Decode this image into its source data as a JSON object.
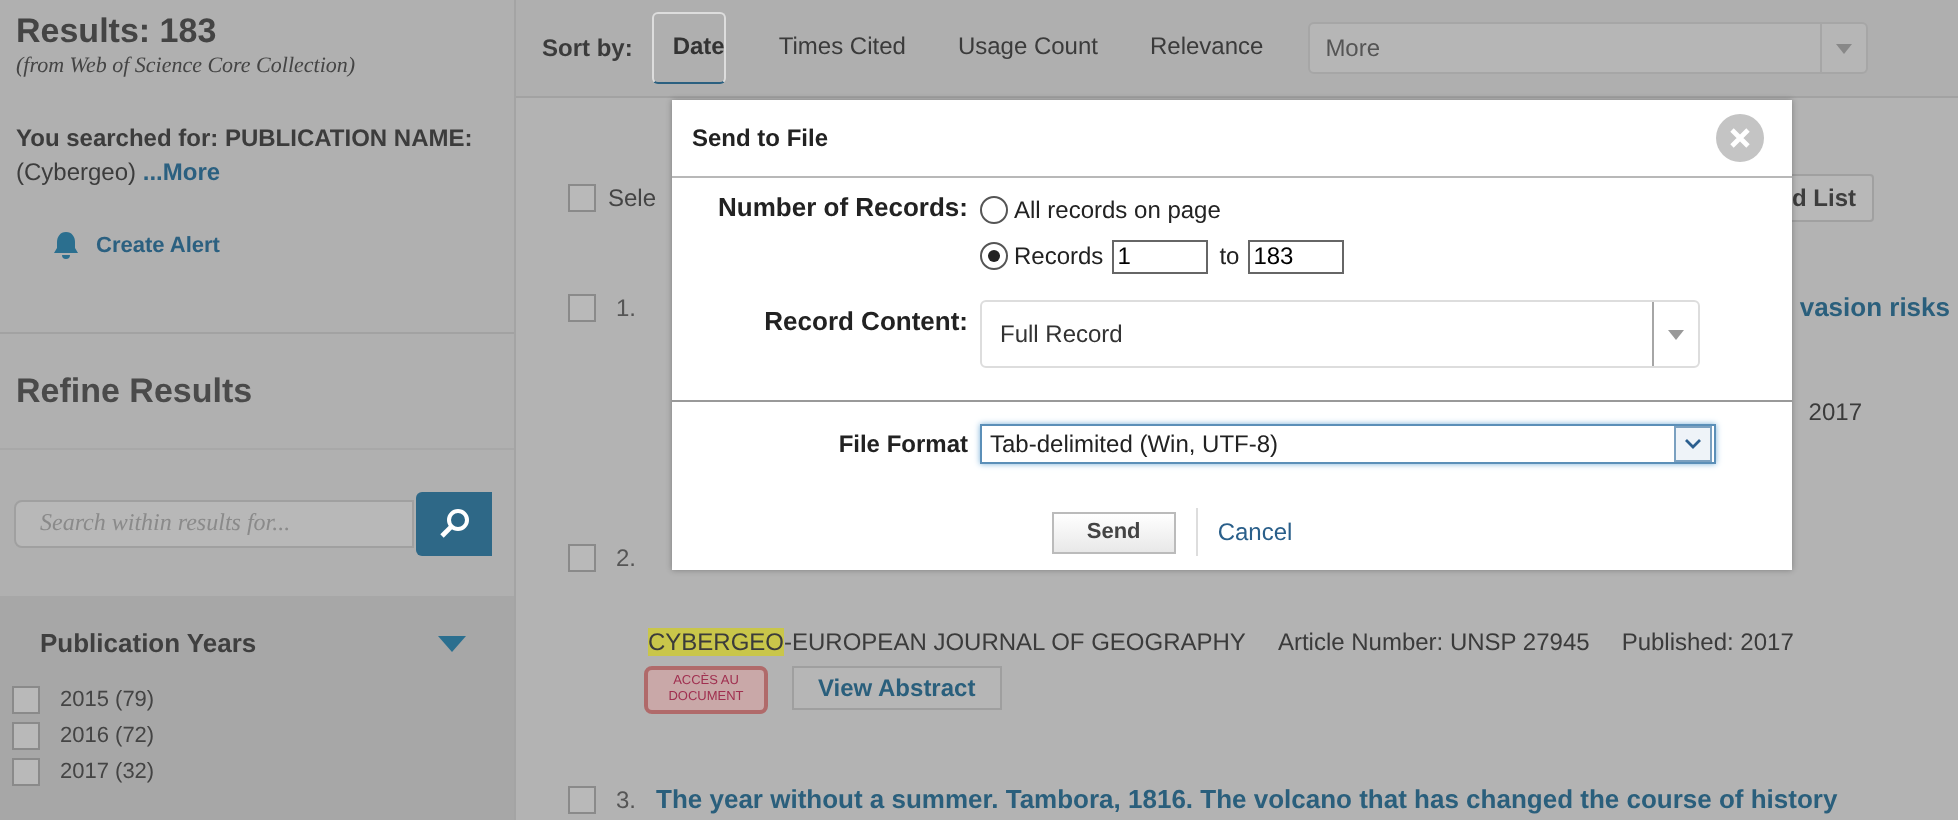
{
  "sidebar": {
    "results_title": "Results: 183",
    "source": "(from Web of Science Core Collection)",
    "search_summary": "**You searched for: PUBLICATION NAME:** (Cybergeo)",
    "more_link": "...More",
    "create_alert": "Create Alert",
    "refine_title": "Refine Results",
    "search": {
      "placeholder": "Search within results for..."
    },
    "facet": {
      "title": "Publication Years",
      "expanded": true,
      "items": [
        {
          "label": "2015 (79)",
          "checked": false
        },
        {
          "label": "2016 (72)",
          "checked": false
        },
        {
          "label": "2017 (32)",
          "checked": false
        }
      ]
    }
  },
  "sort": {
    "label": "Sort by:",
    "options": [
      {
        "label": "Date",
        "selected": true
      },
      {
        "label": "Times Cited",
        "selected": false
      },
      {
        "label": "Usage Count",
        "selected": false
      },
      {
        "label": "Relevance",
        "selected": false
      }
    ],
    "more": "More"
  },
  "results": {
    "select_all": {
      "label": "Sele",
      "checked": false
    },
    "add_list": "d List",
    "items": [
      {
        "number": "1.",
        "checked": false,
        "title": "vasion risks",
        "meta": "2017"
      },
      {
        "number": "2.",
        "checked": false,
        "journal_highlight": "CYBERGEO",
        "journal_rest": "-EUROPEAN JOURNAL OF GEOGRAPHY",
        "article_number": "Article Number: UNSP 27945",
        "published": "Published: 2017",
        "access_button": [
          "ACCÈS AU",
          "DOCUMENT"
        ],
        "abstract_button": "View Abstract"
      },
      {
        "number": "3.",
        "checked": false,
        "title": "The year without a summer. Tambora, 1816. The volcano that has changed the course of history"
      }
    ]
  },
  "dialog": {
    "title": "Send to File",
    "number_label": "Number of Records:",
    "options": [
      {
        "label": "All records on page",
        "selected": false
      },
      {
        "label": "Records",
        "selected": true
      }
    ],
    "from": "1",
    "to_label": "to",
    "to": "183",
    "content_label": "Record Content:",
    "content_value": "Full Record",
    "format_label": "File Format",
    "format_value": "Tab-delimited (Win, UTF-8)",
    "send": "Send",
    "cancel": "Cancel"
  }
}
